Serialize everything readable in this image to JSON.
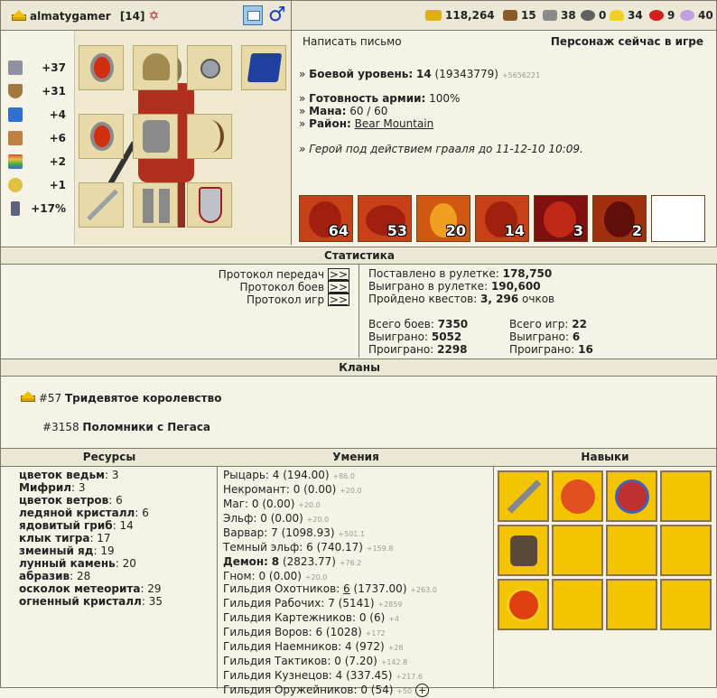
{
  "player": {
    "name": "almatygamer",
    "level": "[14]"
  },
  "resources_top": [
    {
      "icon": "gold-icon",
      "value": "118,264",
      "color": "#e0b010"
    },
    {
      "icon": "wood-icon",
      "value": "15",
      "color": "#8a5a2a"
    },
    {
      "icon": "ore-icon",
      "value": "38",
      "color": "#8a8a8a"
    },
    {
      "icon": "mercury-icon",
      "value": "0",
      "color": "#606060"
    },
    {
      "icon": "sulfur-icon",
      "value": "34",
      "color": "#f0d020"
    },
    {
      "icon": "crystal-icon",
      "value": "9",
      "color": "#d02020"
    },
    {
      "icon": "gems-icon",
      "value": "40",
      "color": "#c0a0e0"
    }
  ],
  "stats": [
    {
      "icon": "attack-icon",
      "value": "+37",
      "color": "#9090a0"
    },
    {
      "icon": "defense-icon",
      "value": "+31",
      "color": "#a07840"
    },
    {
      "icon": "magic-power-icon",
      "value": "+4",
      "color": "#3070d0"
    },
    {
      "icon": "knowledge-icon",
      "value": "+6",
      "color": "#c08040"
    },
    {
      "icon": "luck-icon",
      "value": "+2",
      "color": "#e06060"
    },
    {
      "icon": "morale-icon",
      "value": "+1",
      "color": "#e0c040"
    },
    {
      "icon": "initiative-icon",
      "value": "+17%",
      "color": "#606080"
    }
  ],
  "info": {
    "write_letter": "Написать письмо",
    "status": "Персонаж сейчас в игре",
    "combat_level_label": "Боевой уровень:",
    "combat_level": "14",
    "combat_exp": "(19343779)",
    "combat_exp_plus": "+5656221",
    "army_label": "Готовность армии:",
    "army_value": "100%",
    "mana_label": "Мана:",
    "mana_value": "60 / 60",
    "region_label": "Район:",
    "region_value": "Bear Mountain",
    "grail": "Герой под действием грааля до 11-12-10 10:09."
  },
  "army": [
    "64",
    "53",
    "20",
    "14",
    "3",
    "2",
    ""
  ],
  "stats_section": {
    "title": "Статистика",
    "protocols": [
      {
        "label": "Протокол передач",
        "link": ">>"
      },
      {
        "label": "Протокол боев",
        "link": ">>"
      },
      {
        "label": "Протокол игр",
        "link": ">>"
      }
    ],
    "roulette_bet_label": "Поставлено в рулетке:",
    "roulette_bet": "178,750",
    "roulette_win_label": "Выиграно в рулетке:",
    "roulette_win": "190,600",
    "quests_label": "Пройдено квестов:",
    "quests": "3, 296",
    "quests_suffix": "очков",
    "battles_total_label": "Всего боев:",
    "battles_total": "7350",
    "battles_won_label": "Выиграно:",
    "battles_won": "5052",
    "battles_lost_label": "Проиграно:",
    "battles_lost": "2298",
    "games_total_label": "Всего игр:",
    "games_total": "22",
    "games_won_label": "Выиграно:",
    "games_won": "6",
    "games_lost_label": "Проиграно:",
    "games_lost": "16"
  },
  "clans": {
    "title": "Кланы",
    "items": [
      {
        "id": "#57",
        "name": "Тридевятое королевство"
      },
      {
        "id": "#3158",
        "name": "Поломники с Пегаса"
      }
    ]
  },
  "resources": {
    "title": "Ресурсы",
    "items": [
      {
        "name": "цветок ведьм",
        "value": "3"
      },
      {
        "name": "Мифрил",
        "value": "3"
      },
      {
        "name": "цветок ветров",
        "value": "6"
      },
      {
        "name": "ледяной кристалл",
        "value": "6"
      },
      {
        "name": "ядовитый гриб",
        "value": "14"
      },
      {
        "name": "клык тигра",
        "value": "17"
      },
      {
        "name": "змеиный яд",
        "value": "19"
      },
      {
        "name": "лунный камень",
        "value": "20"
      },
      {
        "name": "абразив",
        "value": "28"
      },
      {
        "name": "осколок метеорита",
        "value": "29"
      },
      {
        "name": "огненный кристалл",
        "value": "35"
      }
    ]
  },
  "skills": {
    "title": "Умения",
    "items": [
      {
        "name": "Рыцарь:",
        "value": "4 (194.00)",
        "plus": "+86.0",
        "bold": false
      },
      {
        "name": "Некромант:",
        "value": "0 (0.00)",
        "plus": "+20.0",
        "bold": false
      },
      {
        "name": "Маг:",
        "value": "0 (0.00)",
        "plus": "+20.0",
        "bold": false
      },
      {
        "name": "Эльф:",
        "value": "0 (0.00)",
        "plus": "+20.0",
        "bold": false
      },
      {
        "name": "Варвар:",
        "value": "7 (1098.93)",
        "plus": "+501.1",
        "bold": false
      },
      {
        "name": "Темный эльф:",
        "value": "6 (740.17)",
        "plus": "+159.8",
        "bold": false
      },
      {
        "name": "Демон:",
        "value": "8",
        "extra": "(2823.77)",
        "plus": "+76.2",
        "bold": true
      },
      {
        "name": "Гном:",
        "value": "0 (0.00)",
        "plus": "+20.0",
        "bold": false
      }
    ],
    "guilds": [
      {
        "name": "Гильдия Охотников:",
        "value": "6",
        "extra": "(1737.00)",
        "plus": "+263.0"
      },
      {
        "name": "Гильдия Рабочих:",
        "value": "7 (5141)",
        "extra": "",
        "plus": "+2859"
      },
      {
        "name": "Гильдия Картежников:",
        "value": "0 (6)",
        "extra": "",
        "plus": "+4"
      },
      {
        "name": "Гильдия Воров:",
        "value": "6 (1028)",
        "extra": "",
        "plus": "+172"
      },
      {
        "name": "Гильдия Наемников:",
        "value": "4 (972)",
        "extra": "",
        "plus": "+28"
      },
      {
        "name": "Гильдия Тактиков:",
        "value": "0 (7.20)",
        "extra": "",
        "plus": "+142.8"
      },
      {
        "name": "Гильдия Кузнецов:",
        "value": "4 (337.45)",
        "extra": "",
        "plus": "+217.6"
      },
      {
        "name": "Гильдия Оружейников:",
        "value": "0 (54)",
        "extra": "",
        "plus": "+50"
      }
    ],
    "expand": "+"
  },
  "talents": {
    "title": "Навыки"
  }
}
